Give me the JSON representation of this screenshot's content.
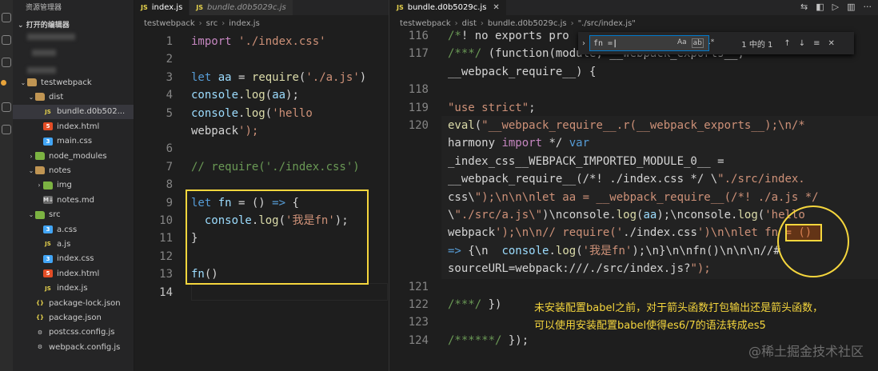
{
  "sidebar": {
    "title": "资源管理器",
    "open_editors": "打开的编辑器",
    "tree": [
      {
        "label": "testwebpack",
        "icon": "folder-icon",
        "kind": "folder",
        "depth": 0,
        "open": true
      },
      {
        "label": "dist",
        "icon": "folder-icon",
        "kind": "folder",
        "depth": 1,
        "open": true
      },
      {
        "label": "bundle.d0b502...",
        "icon": "js-file-icon",
        "kind": "js",
        "depth": 2,
        "selected": true
      },
      {
        "label": "index.html",
        "icon": "html-file-icon",
        "kind": "html",
        "depth": 2
      },
      {
        "label": "main.css",
        "icon": "css-file-icon",
        "kind": "css",
        "depth": 2
      },
      {
        "label": "node_modules",
        "icon": "folder-green-icon",
        "kind": "folder-green",
        "depth": 1,
        "open": false
      },
      {
        "label": "notes",
        "icon": "folder-icon",
        "kind": "folder",
        "depth": 1,
        "open": true
      },
      {
        "label": "img",
        "icon": "folder-green-icon",
        "kind": "folder-green",
        "depth": 2,
        "open": false
      },
      {
        "label": "notes.md",
        "icon": "markdown-file-icon",
        "kind": "md",
        "depth": 2
      },
      {
        "label": "src",
        "icon": "folder-green-icon",
        "kind": "folder-green",
        "depth": 1,
        "open": true
      },
      {
        "label": "a.css",
        "icon": "css-file-icon",
        "kind": "css",
        "depth": 2
      },
      {
        "label": "a.js",
        "icon": "js-file-icon",
        "kind": "js",
        "depth": 2
      },
      {
        "label": "index.css",
        "icon": "css-file-icon",
        "kind": "css",
        "depth": 2
      },
      {
        "label": "index.html",
        "icon": "html-file-icon",
        "kind": "html",
        "depth": 2
      },
      {
        "label": "index.js",
        "icon": "js-file-icon",
        "kind": "js",
        "depth": 2
      },
      {
        "label": "package-lock.json",
        "icon": "json-file-icon",
        "kind": "json",
        "depth": 1
      },
      {
        "label": "package.json",
        "icon": "json-file-icon",
        "kind": "json",
        "depth": 1
      },
      {
        "label": "postcss.config.js",
        "icon": "gear-file-icon",
        "kind": "gear",
        "depth": 1
      },
      {
        "label": "webpack.config.js",
        "icon": "gear-file-icon",
        "kind": "gear",
        "depth": 1
      }
    ]
  },
  "left_editor": {
    "tabs": [
      {
        "label": "index.js",
        "active": true
      },
      {
        "label": "bundle.d0b5029c.js",
        "active": false,
        "italic": true
      }
    ],
    "breadcrumb": [
      "testwebpack",
      "src",
      "index.js"
    ],
    "lines": [
      {
        "n": "1",
        "text": "import './index.css'"
      },
      {
        "n": "2",
        "text": ""
      },
      {
        "n": "3",
        "text": "let aa = require('./a.js')"
      },
      {
        "n": "4",
        "text": "console.log(aa);"
      },
      {
        "n": "5",
        "text": "console.log('hello"
      },
      {
        "n": "",
        "text": "webpack');"
      },
      {
        "n": "6",
        "text": ""
      },
      {
        "n": "7",
        "text": "// require('./index.css')"
      },
      {
        "n": "8",
        "text": ""
      },
      {
        "n": "9",
        "text": "let fn = () => {"
      },
      {
        "n": "10",
        "text": "  console.log('我是fn');"
      },
      {
        "n": "11",
        "text": "}"
      },
      {
        "n": "12",
        "text": ""
      },
      {
        "n": "13",
        "text": "fn()"
      },
      {
        "n": "14",
        "text": ""
      }
    ]
  },
  "right_editor": {
    "tabs": [
      {
        "label": "bundle.d0b5029c.js",
        "active": true
      }
    ],
    "breadcrumb": [
      "testwebpack",
      "dist",
      "bundle.d0b5029c.js",
      "\"./src/index.js\""
    ],
    "lines": [
      {
        "n": "116",
        "text": "/*! no exports pro"
      },
      {
        "n": "117",
        "text": "/***/ (function(module, __webpack_exports__,"
      },
      {
        "n": "",
        "text": "__webpack_require__) {"
      },
      {
        "n": "118",
        "text": ""
      },
      {
        "n": "119",
        "text": "\"use strict\";"
      },
      {
        "n": "120",
        "text": "eval(\"__webpack_require__.r(__webpack_exports__);\\n/*"
      },
      {
        "n": "",
        "text": "harmony import */ var"
      },
      {
        "n": "",
        "text": "_index_css__WEBPACK_IMPORTED_MODULE_0__ ="
      },
      {
        "n": "",
        "text": "__webpack_require__(/*! ./index.css */ \\\"./src/index."
      },
      {
        "n": "",
        "text": "css\\\");\\n\\n\\nlet aa = __webpack_require__(/*! ./a.js */"
      },
      {
        "n": "",
        "text": "\\\"./src/a.js\\\")\\nconsole.log(aa);\\nconsole.log('hello"
      },
      {
        "n": "",
        "text": "webpack');\\n\\n// require('./index.css')\\n\\nlet fn = ()"
      },
      {
        "n": "",
        "text": "=> {\\n  console.log('我是fn');\\n}\\n\\nfn()\\n\\n\\n//#"
      },
      {
        "n": "",
        "text": "sourceURL=webpack:///./src/index.js?\");"
      },
      {
        "n": "121",
        "text": ""
      },
      {
        "n": "122",
        "text": "/***/ })"
      },
      {
        "n": "123",
        "text": ""
      },
      {
        "n": "124",
        "text": "/******/ });"
      }
    ],
    "find": {
      "value": "fn = ",
      "result": "1 中的 1",
      "opts": [
        "Aa",
        "ab",
        ".*"
      ]
    }
  },
  "annotation": {
    "line1": "未安装配置babel之前，对于箭头函数打包输出还是箭头函数，",
    "line2": "可以使用安装配置babel使得es6/7的语法转成es5"
  },
  "watermark": "@稀土掘金技术社区",
  "colors": {
    "highlight": "#f5d63d",
    "keyword": "#569cd6",
    "string": "#ce9178",
    "comment": "#6a9955",
    "function": "#dcdcaa",
    "variable": "#9cdcfe"
  }
}
